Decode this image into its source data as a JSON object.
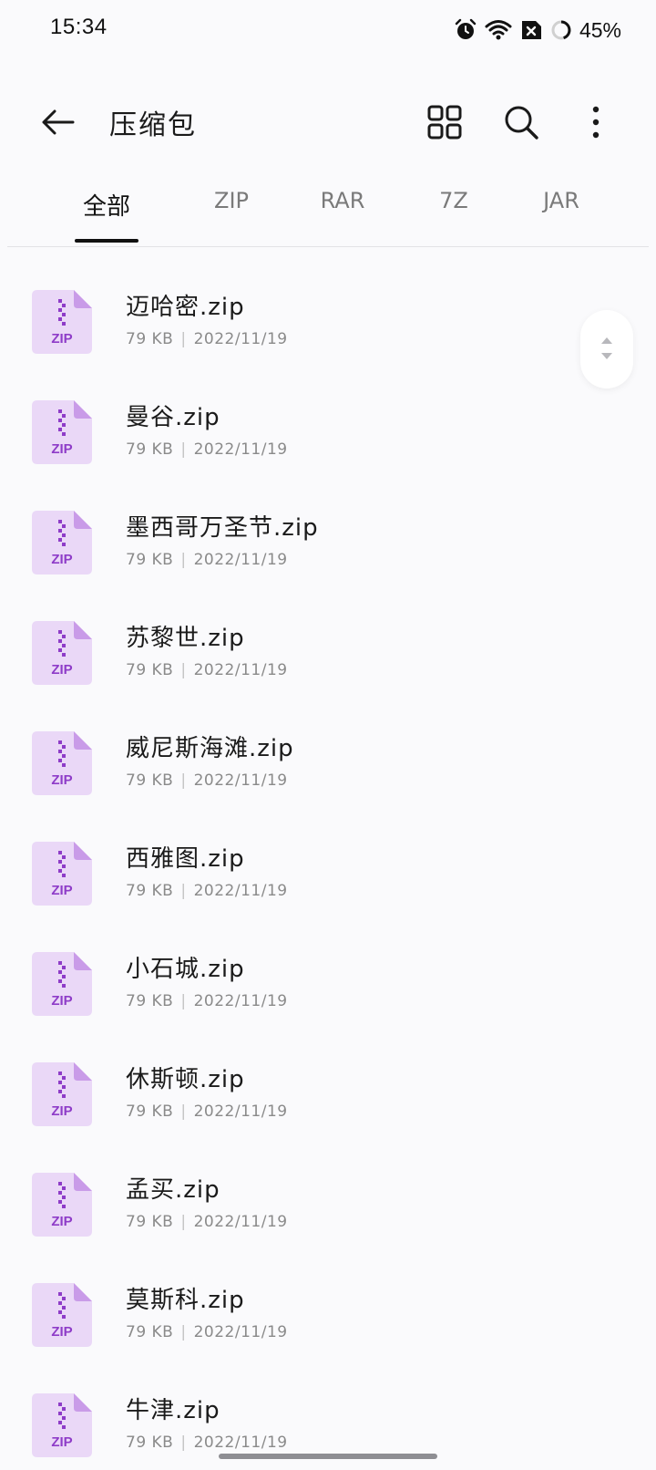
{
  "status_bar": {
    "time": "15:34",
    "battery": "45%",
    "icons": [
      "alarm-icon",
      "wifi-icon",
      "sim-disabled-icon",
      "battery-icon"
    ]
  },
  "header": {
    "title": "压缩包",
    "icons": [
      "back-arrow-icon",
      "grid-view-icon",
      "search-icon",
      "more-vert-icon"
    ]
  },
  "tabs": [
    {
      "label": "全部",
      "active": true
    },
    {
      "label": "ZIP",
      "active": false
    },
    {
      "label": "RAR",
      "active": false
    },
    {
      "label": "7Z",
      "active": false
    },
    {
      "label": "JAR",
      "active": false
    }
  ],
  "file_icon_label": "ZIP",
  "files": [
    {
      "name": "迈哈密.zip",
      "size": "79 KB",
      "date": "2022/11/19"
    },
    {
      "name": "曼谷.zip",
      "size": "79 KB",
      "date": "2022/11/19"
    },
    {
      "name": "墨西哥万圣节.zip",
      "size": "79 KB",
      "date": "2022/11/19"
    },
    {
      "name": "苏黎世.zip",
      "size": "79 KB",
      "date": "2022/11/19"
    },
    {
      "name": "威尼斯海滩.zip",
      "size": "79 KB",
      "date": "2022/11/19"
    },
    {
      "name": "西雅图.zip",
      "size": "79 KB",
      "date": "2022/11/19"
    },
    {
      "name": "小石城.zip",
      "size": "79 KB",
      "date": "2022/11/19"
    },
    {
      "name": "休斯顿.zip",
      "size": "79 KB",
      "date": "2022/11/19"
    },
    {
      "name": "孟买.zip",
      "size": "79 KB",
      "date": "2022/11/19"
    },
    {
      "name": "莫斯科.zip",
      "size": "79 KB",
      "date": "2022/11/19"
    },
    {
      "name": "牛津.zip",
      "size": "79 KB",
      "date": "2022/11/19"
    }
  ],
  "meta_separator": "|",
  "colors": {
    "background": "#fafafc",
    "zip_icon_bg": "#ead8f7",
    "zip_icon_accent": "#8e3cc8",
    "tab_active": "#111111",
    "tab_inactive": "#7a7a7a"
  }
}
